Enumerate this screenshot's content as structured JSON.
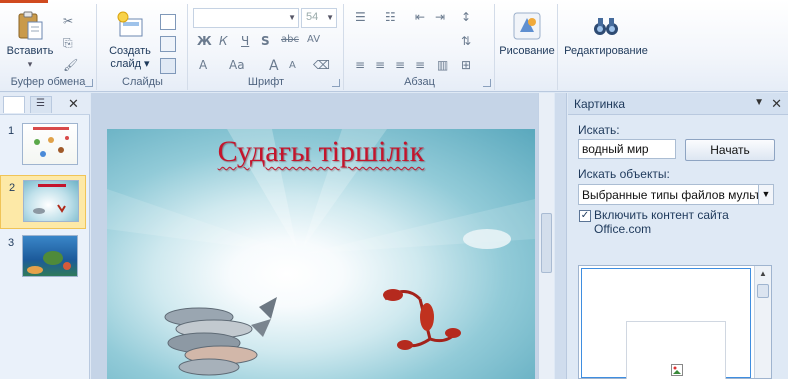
{
  "ribbon": {
    "clipboard": {
      "paste_label": "Вставить",
      "group_label": "Буфер обмена"
    },
    "slides": {
      "new_slide_label": "Создать\nслайд",
      "new_slide_l1": "Создать",
      "new_slide_l2": "слайд ▾",
      "group_label": "Слайды"
    },
    "font": {
      "font_name": "",
      "font_size": "54",
      "group_label": "Шрифт",
      "bold": "Ж",
      "italic": "К",
      "underline": "Ч",
      "strike": "abc",
      "spacing": "AV",
      "case": "Aa",
      "color": "A",
      "grow": "A",
      "shrink": "A"
    },
    "paragraph": {
      "group_label": "Абзац"
    },
    "drawing": {
      "label": "Рисование"
    },
    "editing": {
      "label": "Редактирование"
    }
  },
  "slides_panel": {
    "thumbnails": [
      {
        "number": "1"
      },
      {
        "number": "2"
      },
      {
        "number": "3"
      }
    ]
  },
  "slide": {
    "title": "Судағы тіршілік"
  },
  "clipart_pane": {
    "title": "Картинка",
    "search_label": "Искать:",
    "search_value": "водный мир",
    "go_button": "Начать",
    "results_label": "Искать объекты:",
    "results_value": "Выбранные типы файлов мультимедиа",
    "include_office": "Включить контент сайта Office.com",
    "include_office_checked": true
  },
  "colors": {
    "title_red": "#c4142c",
    "accent": "#d04a1f",
    "selection": "#3f8ee0"
  }
}
